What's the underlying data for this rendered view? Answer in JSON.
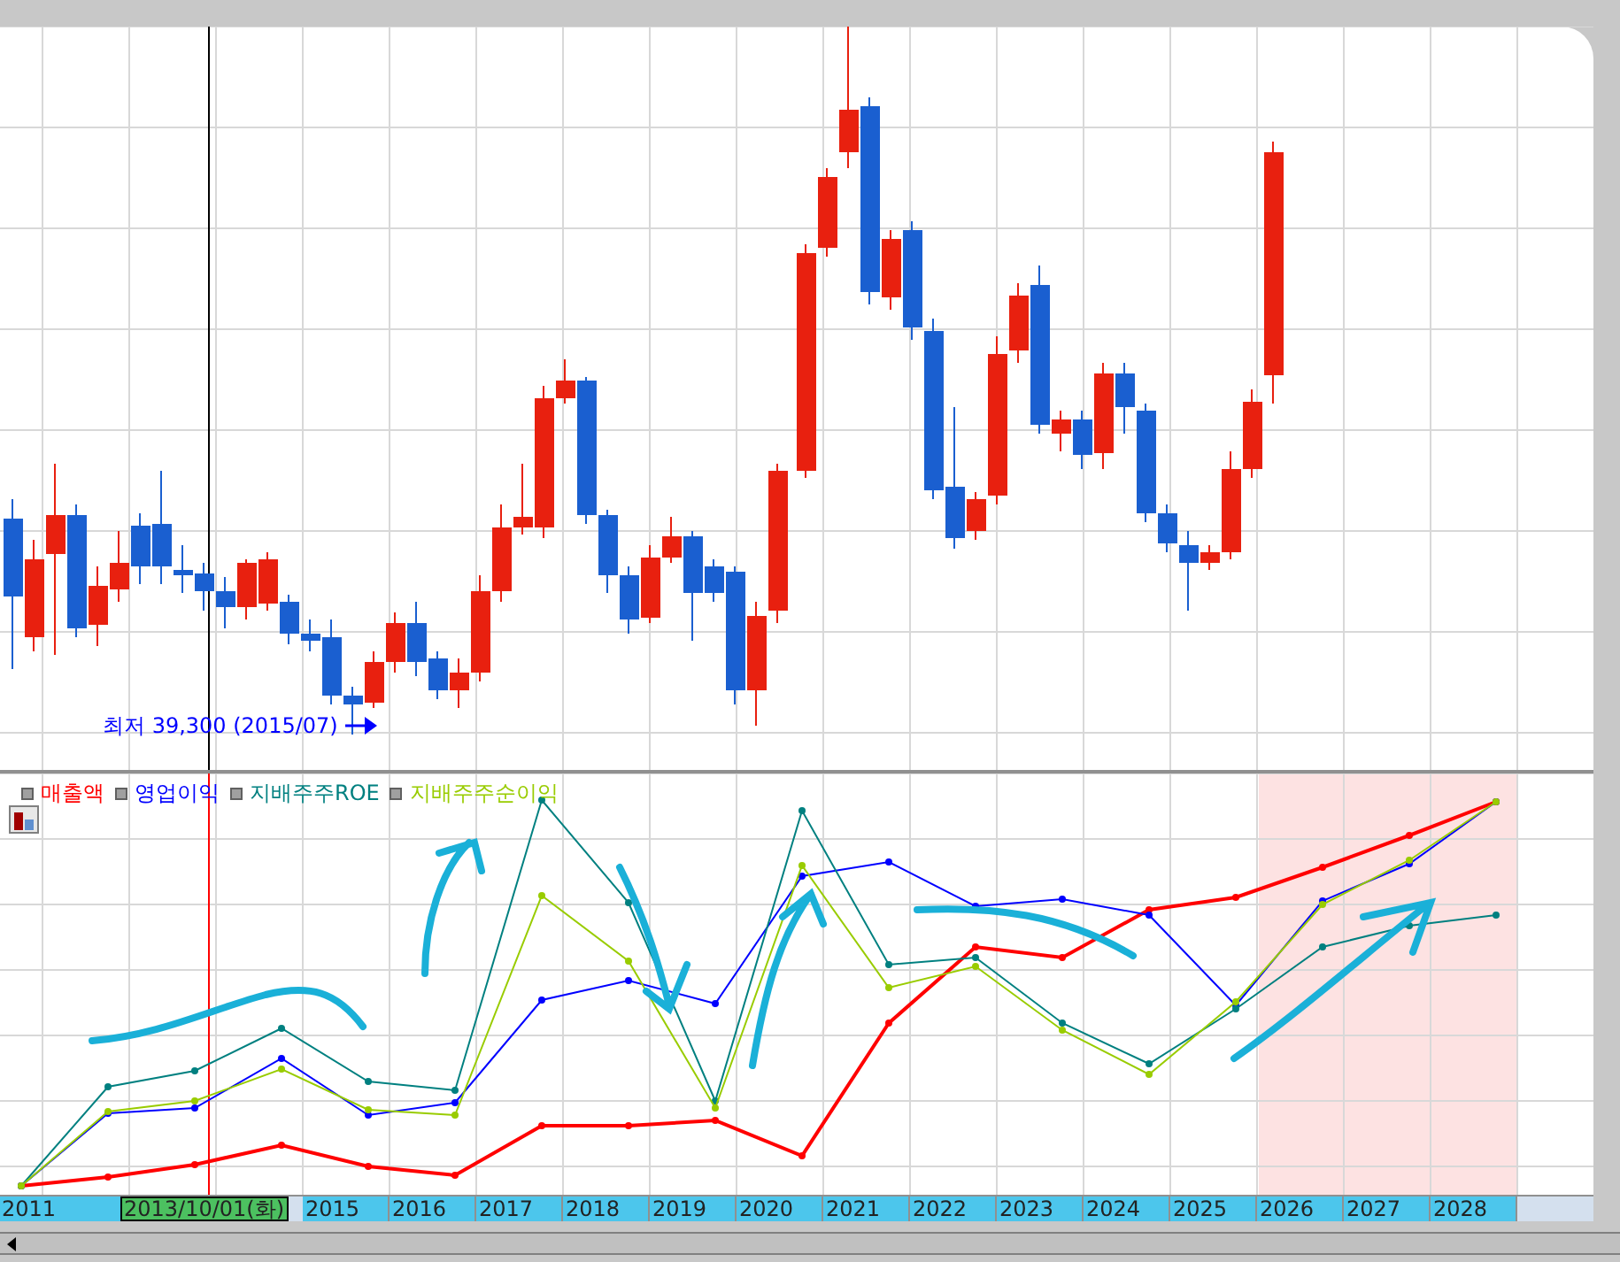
{
  "price_chart": {
    "low_label": "최저 39,300 (2015/07)"
  },
  "legend": [
    {
      "label": "매출액",
      "color": "#ff0000"
    },
    {
      "label": "영업이익",
      "color": "#0000ff"
    },
    {
      "label": "지배주주ROE",
      "color": "#008080"
    },
    {
      "label": "지배주주순이익",
      "color": "#99cc00"
    }
  ],
  "x_axis": {
    "first_label": "2011",
    "cursor_date": "2013/10/01(화)",
    "labels": [
      "2015",
      "2016",
      "2017",
      "2018",
      "2019",
      "2020",
      "2021",
      "2022",
      "2023",
      "2024",
      "2025",
      "2026",
      "2027",
      "2028"
    ]
  }
}
